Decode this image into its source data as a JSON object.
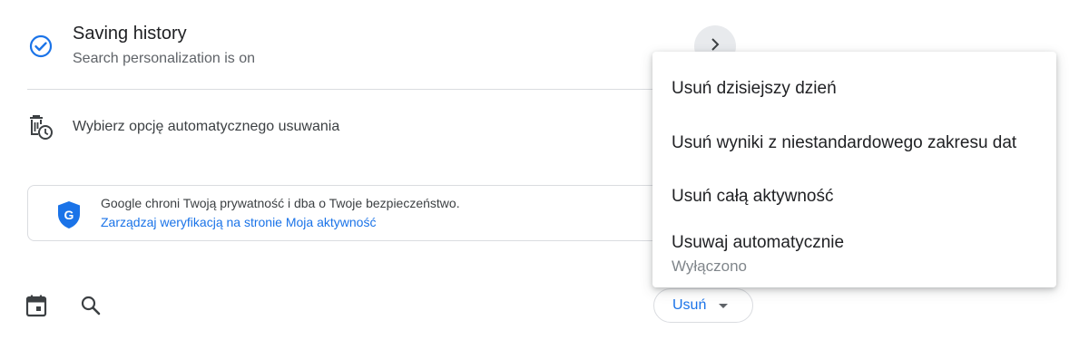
{
  "history": {
    "title": "Saving history",
    "subtitle": "Search personalization is on"
  },
  "autodelete": {
    "label": "Wybierz opcję automatycznego usuwania"
  },
  "protection": {
    "text": "Google chroni Twoją prywatność i dba o Twoje bezpieczeństwo.",
    "link": "Zarządzaj weryfikacją na stronie Moja aktywność"
  },
  "toolbar": {
    "delete_label": "Usuń"
  },
  "menu": {
    "items": [
      {
        "label": "Usuń dzisiejszy dzień"
      },
      {
        "label": "Usuń wyniki z niestandardowego zakresu dat"
      },
      {
        "label": "Usuń całą aktywność"
      },
      {
        "label": "Usuwaj automatycznie",
        "sublabel": "Wyłączono"
      }
    ]
  },
  "colors": {
    "accent": "#1a73e8",
    "text": "#202124",
    "secondary_text": "#5f6368"
  },
  "icons": [
    "check-circle-icon",
    "chevron-right-icon",
    "auto-delete-icon",
    "google-shield-icon",
    "calendar-icon",
    "search-icon",
    "caret-down-icon"
  ]
}
